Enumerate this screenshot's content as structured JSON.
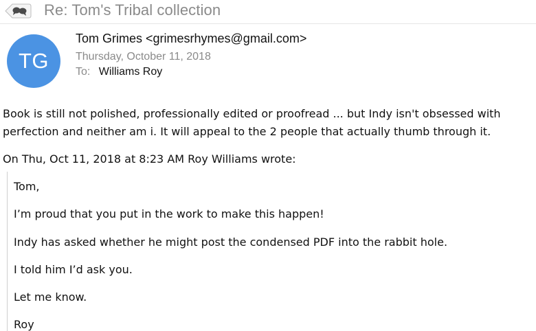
{
  "header_bar": {
    "subject": "Re: Tom's Tribal collection",
    "thread_icon": "conversation-bubbles-icon"
  },
  "message": {
    "avatar_initials": "TG",
    "avatar_color": "#4b93e3",
    "from": "Tom Grimes <grimesrhymes@gmail.com>",
    "date": "Thursday, October 11, 2018",
    "to_label": "To:",
    "to_name": "Williams Roy",
    "body": "Book is still not polished, professionally edited or proofread ... but Indy isn't obsessed with perfection and neither am i. It will appeal to the 2 people that actually thumb through it."
  },
  "quoted": {
    "intro": "On Thu, Oct 11, 2018 at 8:23 AM Roy Williams wrote:",
    "lines": [
      "Tom,",
      "I’m proud that you put in the work to make this happen!",
      "Indy has asked whether he might post the condensed PDF into the rabbit hole.",
      "I told him I’d ask you.",
      "Let me know.",
      "Roy"
    ]
  }
}
